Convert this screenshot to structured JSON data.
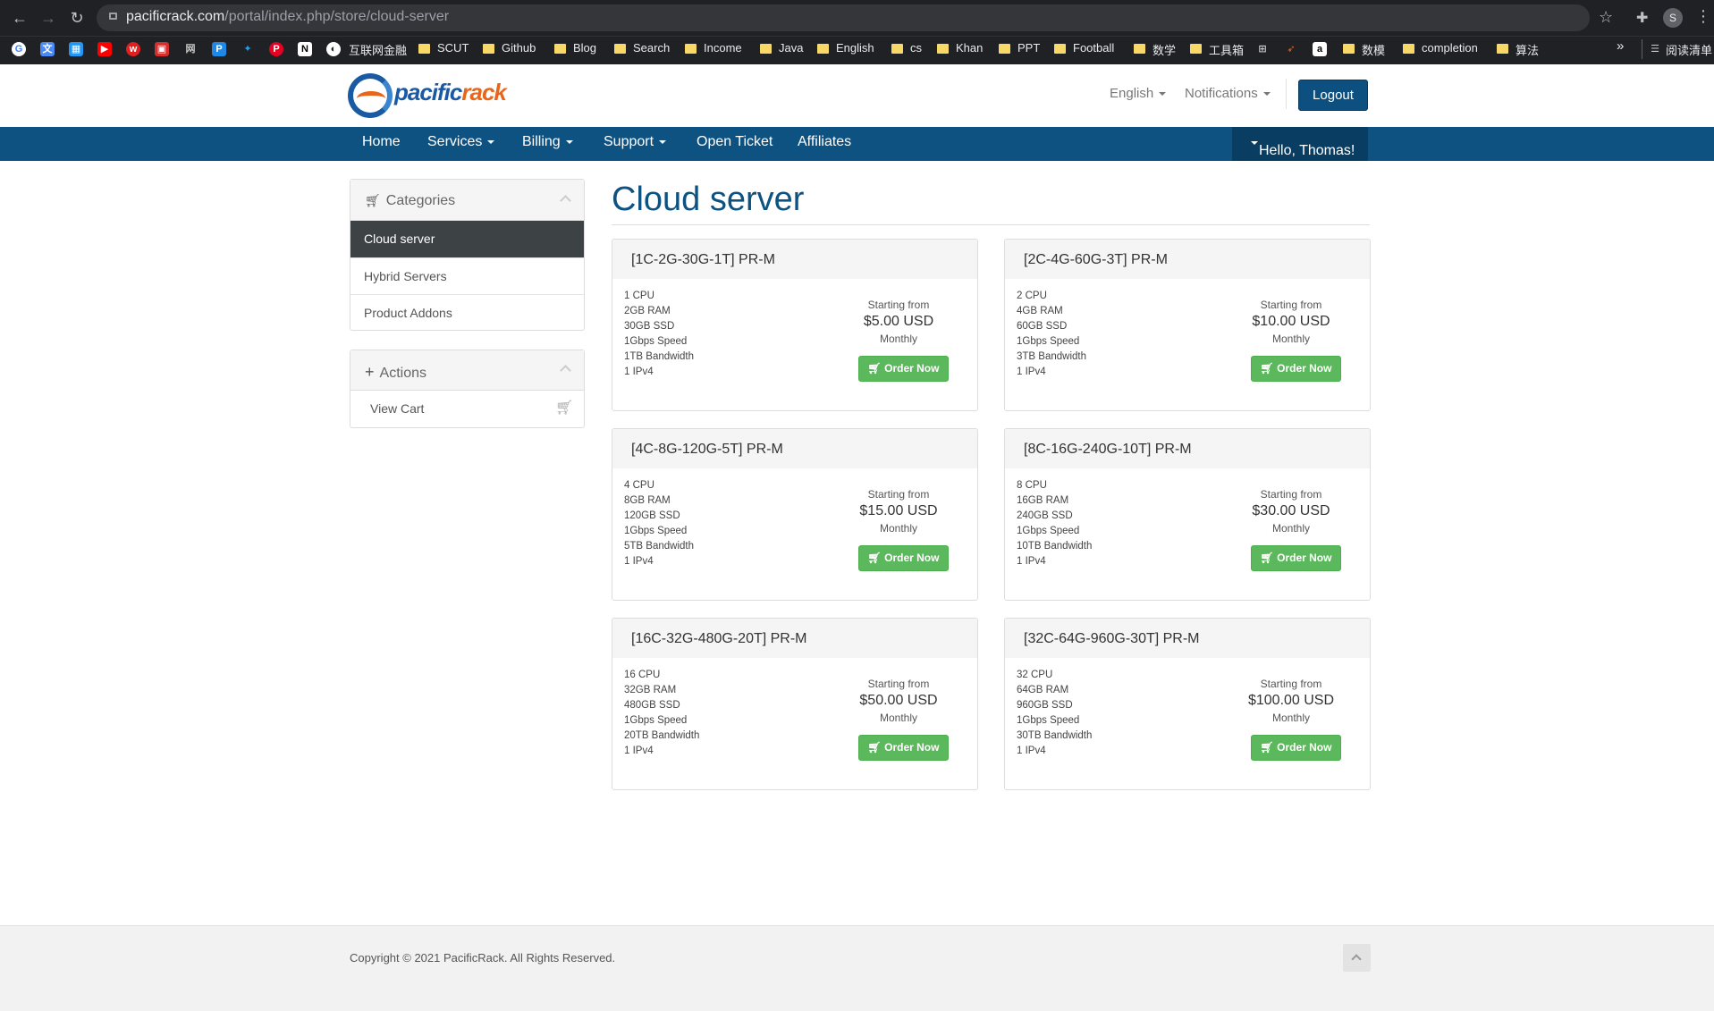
{
  "browser": {
    "url_host": "pacificrack.com",
    "url_path": "/portal/index.php/store/cloud-server",
    "profile_initial": "S",
    "bookmarks_overflow": "»",
    "reading_list": "阅读清单",
    "bookmarks": [
      "互联网金融",
      "SCUT",
      "Github",
      "Blog",
      "Search",
      "Income",
      "Java",
      "English",
      "cs",
      "Khan",
      "PPT",
      "Football",
      "数学",
      "工具箱",
      "数模",
      "completion",
      "算法"
    ]
  },
  "brand": {
    "logo_text_a": "pacific",
    "logo_text_b": "rack",
    "colors": {
      "primary": "#0e5282",
      "accent": "#e8661b",
      "success": "#5cb85c"
    }
  },
  "header": {
    "language": "English",
    "notifications": "Notifications",
    "logout": "Logout"
  },
  "nav": {
    "home": "Home",
    "services": "Services",
    "billing": "Billing",
    "support": "Support",
    "open_ticket": "Open Ticket",
    "affiliates": "Affiliates",
    "hello": "Hello, Thomas!"
  },
  "sidebar": {
    "categories_title": "Categories",
    "categories": [
      "Cloud server",
      "Hybrid Servers",
      "Product Addons"
    ],
    "actions_title": "Actions",
    "view_cart": "View Cart"
  },
  "main": {
    "title": "Cloud server"
  },
  "products": [
    {
      "name": "[1C-2G-30G-1T] PR-M",
      "specs": [
        "1 CPU",
        "2GB RAM",
        "30GB SSD",
        "1Gbps Speed",
        "1TB Bandwidth",
        "1 IPv4"
      ],
      "starting": "Starting from",
      "price": "$5.00 USD",
      "cycle": "Monthly",
      "order": "Order Now"
    },
    {
      "name": "[2C-4G-60G-3T] PR-M",
      "specs": [
        "2 CPU",
        "4GB RAM",
        "60GB SSD",
        "1Gbps Speed",
        "3TB Bandwidth",
        "1 IPv4"
      ],
      "starting": "Starting from",
      "price": "$10.00 USD",
      "cycle": "Monthly",
      "order": "Order Now"
    },
    {
      "name": "[4C-8G-120G-5T] PR-M",
      "specs": [
        "4 CPU",
        "8GB RAM",
        "120GB SSD",
        "1Gbps Speed",
        "5TB Bandwidth",
        "1 IPv4"
      ],
      "starting": "Starting from",
      "price": "$15.00 USD",
      "cycle": "Monthly",
      "order": "Order Now"
    },
    {
      "name": "[8C-16G-240G-10T] PR-M",
      "specs": [
        "8 CPU",
        "16GB RAM",
        "240GB SSD",
        "1Gbps Speed",
        "10TB Bandwidth",
        "1 IPv4"
      ],
      "starting": "Starting from",
      "price": "$30.00 USD",
      "cycle": "Monthly",
      "order": "Order Now"
    },
    {
      "name": "[16C-32G-480G-20T] PR-M",
      "specs": [
        "16 CPU",
        "32GB RAM",
        "480GB SSD",
        "1Gbps Speed",
        "20TB Bandwidth",
        "1 IPv4"
      ],
      "starting": "Starting from",
      "price": "$50.00 USD",
      "cycle": "Monthly",
      "order": "Order Now"
    },
    {
      "name": "[32C-64G-960G-30T] PR-M",
      "specs": [
        "32 CPU",
        "64GB RAM",
        "960GB SSD",
        "1Gbps Speed",
        "30TB Bandwidth",
        "1 IPv4"
      ],
      "starting": "Starting from",
      "price": "$100.00 USD",
      "cycle": "Monthly",
      "order": "Order Now"
    }
  ],
  "footer": {
    "copyright": "Copyright © 2021 PacificRack. All Rights Reserved."
  }
}
